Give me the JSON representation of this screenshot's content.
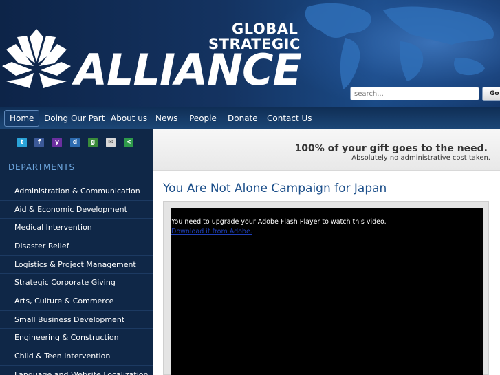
{
  "header": {
    "logo_line1": "GLOBAL",
    "logo_line2": "STRATEGIC",
    "logo_main": "ALLIANCE",
    "search": {
      "placeholder": "search...",
      "button_label": "Go"
    }
  },
  "nav": {
    "items": [
      {
        "label": "Home",
        "active": true
      },
      {
        "label": "Doing Our Part"
      },
      {
        "label": "About us"
      },
      {
        "label": "News"
      },
      {
        "label": "People"
      },
      {
        "label": "Donate"
      },
      {
        "label": "Contact Us"
      }
    ]
  },
  "sidebar": {
    "social_icons": [
      "twitter-icon",
      "facebook-icon",
      "yahoo-icon",
      "digg-icon",
      "google-icon",
      "email-icon",
      "share-icon"
    ],
    "departments_heading": "DEPARTMENTS",
    "departments": [
      "Administration & Communication",
      "Aid & Economic Development",
      "Medical Intervention",
      "Disaster Relief",
      "Logistics & Project Management",
      "Strategic Corporate Giving",
      "Arts, Culture & Commerce",
      "Small Business Development",
      "Engineering & Construction",
      "Child & Teen Intervention",
      "Language and Website Localization"
    ]
  },
  "content": {
    "promo_headline": "100% of your gift goes to the need.",
    "promo_sub": "Absolutely no administrative cost taken.",
    "title": "You Are Not Alone Campaign for Japan",
    "video": {
      "message": "You need to upgrade your Adobe Flash Player to watch this video.",
      "link": "Download it from Adobe."
    }
  },
  "colors": {
    "header_bg": "#143361",
    "sidebar_bg": "#0f2747",
    "heading_accent": "#6fa8e0",
    "title_blue": "#1c4f8a"
  }
}
